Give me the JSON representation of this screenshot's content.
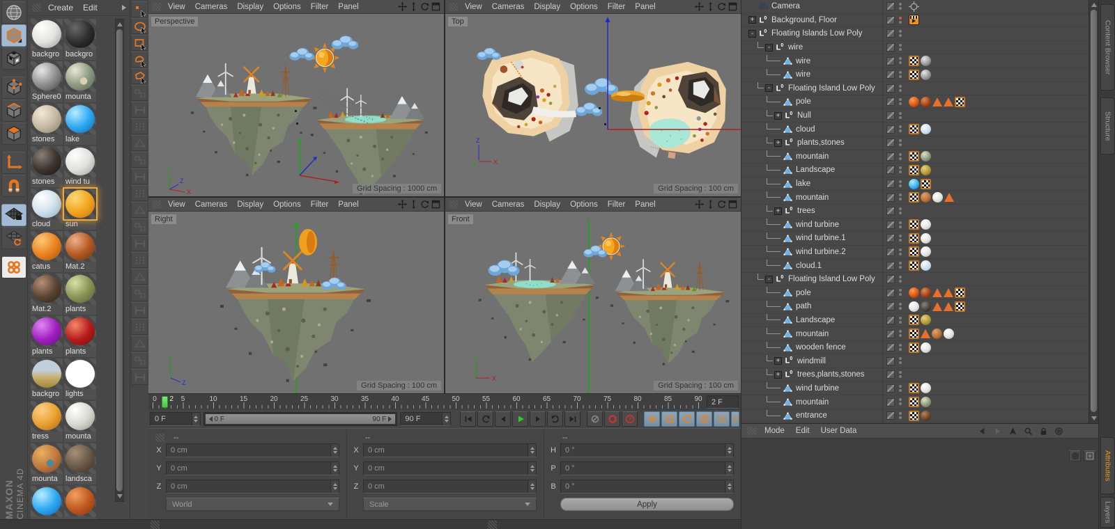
{
  "brand": {
    "maxon": "MAXON",
    "product": "CINEMA 4D"
  },
  "colors": {
    "accent": "#e8821e",
    "selection_blue": "#a2bad4",
    "play_green": "#2fc82f",
    "record_red": "#d23030"
  },
  "left_toolbar_icons": [
    "globe-icon",
    "make-editable-icon",
    "model-mode-icon",
    "points-mode-icon",
    "edges-mode-icon",
    "polygons-mode-icon",
    "axis-mode-icon",
    "snap-icon",
    "lock-workplane-icon",
    "workplane-mode-icon",
    "mograph-icon"
  ],
  "material_manager": {
    "menu": [
      "Create",
      "Edit"
    ],
    "more_icon": "submenu-arrow-icon",
    "materials": [
      {
        "name": "backgro",
        "style": "radial",
        "hi": "#ffffff",
        "base": "#e2e2e0",
        "lo": "#9a9a98"
      },
      {
        "name": "backgro",
        "style": "radial",
        "hi": "#6a6a6a",
        "base": "#2e2e2e",
        "lo": "#111111"
      },
      {
        "name": "Sphere0",
        "style": "radial",
        "hi": "#e8e8e8",
        "base": "#8e8e8e",
        "lo": "#4a4a4a"
      },
      {
        "name": "mounta",
        "style": "mottled",
        "hi": "#e8e8d8",
        "base": "#8e9a80",
        "lo": "#5a665a",
        "spot": "#d8d2b0"
      },
      {
        "name": "stones",
        "style": "radial",
        "hi": "#f0ead8",
        "base": "#c6b8a2",
        "lo": "#8a7e6a"
      },
      {
        "name": "lake",
        "style": "radial",
        "hi": "#b8ecff",
        "base": "#2fa9f2",
        "lo": "#1068b8"
      },
      {
        "name": "stones",
        "style": "radial",
        "hi": "#8a8078",
        "base": "#3c3430",
        "lo": "#1a1614"
      },
      {
        "name": "wind tu",
        "style": "radial",
        "hi": "#ffffff",
        "base": "#e0e0dc",
        "lo": "#a0a09a"
      },
      {
        "name": "cloud",
        "style": "radial",
        "hi": "#ffffff",
        "base": "#cfe0ec",
        "lo": "#92aec2"
      },
      {
        "name": "sun",
        "style": "radial",
        "hi": "#ffd878",
        "base": "#f2a41e",
        "lo": "#c87410",
        "selected": true
      },
      {
        "name": "catus",
        "style": "radial",
        "hi": "#ffc878",
        "base": "#e8821e",
        "lo": "#a85210"
      },
      {
        "name": "Mat.2",
        "style": "radial",
        "hi": "#f0b088",
        "base": "#b35a24",
        "lo": "#703413"
      },
      {
        "name": "Mat.2",
        "style": "radial",
        "hi": "#b89078",
        "base": "#5a4332",
        "lo": "#30241a"
      },
      {
        "name": "plants",
        "style": "radial",
        "hi": "#d8e0a8",
        "base": "#8a9456",
        "lo": "#57613a"
      },
      {
        "name": "plants",
        "style": "radial",
        "hi": "#e088f0",
        "base": "#a020c0",
        "lo": "#601080"
      },
      {
        "name": "plants",
        "style": "radial",
        "hi": "#f08868",
        "base": "#b81c1c",
        "lo": "#700e0e"
      },
      {
        "name": "backgro",
        "style": "sky",
        "hi": "#c2cedb",
        "base": "#c8b070",
        "lo": "#a08838"
      },
      {
        "name": "lights",
        "style": "flat",
        "base": "#ffffff"
      },
      {
        "name": "tress",
        "style": "radial",
        "hi": "#ffd088",
        "base": "#e8a030",
        "lo": "#b06a14"
      },
      {
        "name": "mounta",
        "style": "radial",
        "hi": "#ffffff",
        "base": "#d8d8d2",
        "lo": "#9a9a92"
      },
      {
        "name": "mounta",
        "style": "earth",
        "hi": "#e8b060",
        "base": "#c07840",
        "lo": "#7a4820",
        "spot": "#4a8a9a"
      },
      {
        "name": "landsca",
        "style": "radial",
        "hi": "#a89078",
        "base": "#6a5848",
        "lo": "#3c3028"
      },
      {
        "name": "",
        "style": "radial",
        "hi": "#b8ecff",
        "base": "#2fa9f2",
        "lo": "#1068b8",
        "cut": true
      },
      {
        "name": "",
        "style": "radial",
        "hi": "#f0a060",
        "base": "#c05820",
        "lo": "#803810",
        "cut": true
      }
    ]
  },
  "selection_tools": [
    "live-selection",
    "circle-selection",
    "rectangle-selection",
    "lasso-selection",
    "polygon-selection"
  ],
  "selection_extra_count": 18,
  "viewport_menu": [
    "View",
    "Cameras",
    "Display",
    "Options",
    "Filter",
    "Panel"
  ],
  "viewport_icons": [
    "pan-icon",
    "dolly-icon",
    "rotate-icon",
    "maximize-icon"
  ],
  "viewports": [
    {
      "id": "perspective",
      "label": "Perspective",
      "grid_spacing": "Grid Spacing : 1000 cm"
    },
    {
      "id": "top",
      "label": "Top",
      "grid_spacing": "Grid Spacing : 100 cm"
    },
    {
      "id": "right",
      "label": "Right",
      "grid_spacing": "Grid Spacing : 100 cm"
    },
    {
      "id": "front",
      "label": "Front",
      "grid_spacing": "Grid Spacing : 100 cm"
    }
  ],
  "timeline": {
    "labels": [
      0,
      5,
      10,
      15,
      20,
      25,
      30,
      35,
      40,
      45,
      50,
      55,
      60,
      65,
      70,
      75,
      80,
      85,
      90
    ],
    "max": 90,
    "current_frame": "2",
    "current_field": "2 F",
    "start_field": "0 F",
    "range_start": "0 F",
    "range_end": "90 F",
    "end_field": "90 F"
  },
  "transport": {
    "buttons": [
      "go-to-start",
      "play-backwards",
      "previous-frame",
      "play-forwards",
      "next-frame",
      "play-cycle",
      "go-to-end"
    ],
    "record": [
      "record-disabled",
      "autokeying",
      "record-help"
    ],
    "key_toggles": [
      "key-position",
      "key-scale",
      "key-rotation",
      "key-parameter",
      "key-pla",
      "key-extra"
    ]
  },
  "coordinates": {
    "groups": [
      {
        "header": "--",
        "grip": true,
        "rows": [
          {
            "label": "X",
            "value": "0 cm"
          },
          {
            "label": "Y",
            "value": "0 cm"
          },
          {
            "label": "Z",
            "value": "0 cm"
          }
        ],
        "footer": {
          "type": "dropdown",
          "label": "World"
        }
      },
      {
        "header": "--",
        "rows": [
          {
            "label": "X",
            "value": "0 cm"
          },
          {
            "label": "Y",
            "value": "0 cm"
          },
          {
            "label": "Z",
            "value": "0 cm"
          }
        ],
        "footer": {
          "type": "dropdown",
          "label": "Scale"
        }
      },
      {
        "header": "--",
        "rows": [
          {
            "label": "H",
            "value": "0 °"
          },
          {
            "label": "P",
            "value": "0 °"
          },
          {
            "label": "B",
            "value": "0 °"
          }
        ],
        "footer": {
          "type": "button",
          "label": "Apply"
        }
      }
    ]
  },
  "object_manager": {
    "rows": [
      {
        "i": 0,
        "t": "camera",
        "l": "Camera",
        "g": [
          "target"
        ]
      },
      {
        "i": 0,
        "t": "null",
        "e": "plus",
        "l": "Background, Floor",
        "r": true,
        "g": [
          "film"
        ]
      },
      {
        "i": 0,
        "t": "null",
        "e": "minus",
        "l": "Floating Islands Low Poly",
        "g": []
      },
      {
        "i": 1,
        "t": "null",
        "e": "minus",
        "l": "wire",
        "g": []
      },
      {
        "i": 2,
        "t": "poly",
        "l": "wire",
        "g": [
          "checker",
          "sphere-grey"
        ]
      },
      {
        "i": 2,
        "t": "poly",
        "l": "wire",
        "g": [
          "checker",
          "sphere-grey"
        ]
      },
      {
        "i": 1,
        "t": "null",
        "e": "minus",
        "l": "Floating Island Low Poly",
        "g": []
      },
      {
        "i": 2,
        "t": "poly",
        "l": "pole",
        "g": [
          "sphere-orange",
          "sphere-rust",
          "tri",
          "tri",
          "checker"
        ]
      },
      {
        "i": 2,
        "t": "null",
        "e": "plus",
        "l": "Null",
        "g": []
      },
      {
        "i": 2,
        "t": "poly",
        "l": "cloud",
        "g": [
          "checker",
          "sphere-cloud"
        ]
      },
      {
        "i": 2,
        "t": "null",
        "e": "plus",
        "l": "plants,stones",
        "g": []
      },
      {
        "i": 2,
        "t": "poly",
        "l": "mountain",
        "g": [
          "checker",
          "sphere-mottled"
        ]
      },
      {
        "i": 2,
        "t": "poly",
        "l": "Landscape",
        "g": [
          "checker",
          "sphere-olive"
        ]
      },
      {
        "i": 2,
        "t": "poly",
        "l": "lake",
        "g": [
          "sphere-lake",
          "checker"
        ]
      },
      {
        "i": 2,
        "t": "poly",
        "l": "mountain",
        "g": [
          "checker",
          "sphere-earth",
          "sphere-white",
          "tri"
        ]
      },
      {
        "i": 2,
        "t": "null",
        "e": "plus",
        "l": "trees",
        "g": []
      },
      {
        "i": 2,
        "t": "poly",
        "l": "wind turbine",
        "g": [
          "checker",
          "sphere-white"
        ]
      },
      {
        "i": 2,
        "t": "poly",
        "l": "wind turbine.1",
        "g": [
          "checker",
          "sphere-white"
        ]
      },
      {
        "i": 2,
        "t": "poly",
        "l": "wind turbine.2",
        "g": [
          "checker",
          "sphere-white"
        ]
      },
      {
        "i": 2,
        "t": "poly",
        "l": "cloud.1",
        "g": [
          "checker",
          "sphere-cloud"
        ]
      },
      {
        "i": 1,
        "t": "null",
        "e": "minus",
        "l": "Floating Island Low Poly",
        "g": []
      },
      {
        "i": 2,
        "t": "poly",
        "l": "pole",
        "g": [
          "sphere-orange",
          "sphere-rust",
          "tri",
          "tri",
          "checker"
        ]
      },
      {
        "i": 2,
        "t": "poly",
        "l": "path",
        "g": [
          "sphere-white",
          "sphere-dark",
          "tri",
          "tri",
          "checker"
        ]
      },
      {
        "i": 2,
        "t": "poly",
        "l": "Landscape",
        "g": [
          "checker",
          "sphere-olive"
        ]
      },
      {
        "i": 2,
        "t": "poly",
        "l": "mountain",
        "g": [
          "checker",
          "tri",
          "sphere-earth",
          "sphere-white"
        ]
      },
      {
        "i": 2,
        "t": "poly",
        "l": "wooden fence",
        "g": [
          "checker",
          "sphere-white"
        ]
      },
      {
        "i": 2,
        "t": "null",
        "e": "plus",
        "l": "windmill",
        "g": []
      },
      {
        "i": 2,
        "t": "null",
        "e": "plus",
        "l": "trees,plants,stones",
        "g": []
      },
      {
        "i": 2,
        "t": "poly",
        "l": "wind turbine",
        "g": [
          "checker",
          "sphere-white"
        ]
      },
      {
        "i": 2,
        "t": "poly",
        "l": "mountain",
        "g": [
          "checker",
          "sphere-mottled"
        ]
      },
      {
        "i": 2,
        "t": "poly",
        "l": "entrance",
        "g": [
          "checker",
          "sphere-brown"
        ]
      }
    ]
  },
  "tag_colors": {
    "grey": [
      "#e6e6e6",
      "#9a9a9a",
      "#565656"
    ],
    "cloud": [
      "#f4faff",
      "#cfe0ec",
      "#8caec6"
    ],
    "mottled": [
      "#dee2c4",
      "#8e9a80",
      "#57645a"
    ],
    "olive": [
      "#e6d07c",
      "#b29a3a",
      "#6e5e1c"
    ],
    "lake": [
      "#b0ecff",
      "#38b2f2",
      "#0f6fc0"
    ],
    "earth": [
      "#e2a262",
      "#b87138",
      "#63381a"
    ],
    "white": [
      "#ffffff",
      "#e3e3df",
      "#a6a6a0"
    ],
    "orange": [
      "#ff9b52",
      "#d85812",
      "#7e2d07"
    ],
    "rust": [
      "#dc8c52",
      "#a34219",
      "#541f06"
    ],
    "dark": [
      "#8e857c",
      "#4a443e",
      "#1d1a17"
    ],
    "brown": [
      "#b4845c",
      "#6d472a",
      "#30190b"
    ]
  },
  "attribute_manager": {
    "menu": [
      "Mode",
      "Edit",
      "User Data"
    ],
    "icons": [
      "back-icon",
      "forward-icon",
      "pick-arrow-icon",
      "search-icon",
      "lock-icon",
      "target-icon"
    ]
  },
  "side_tabs": {
    "top": [
      "Content Browser",
      "Structure"
    ],
    "bottom": [
      {
        "label": "Attributes",
        "active": true
      },
      {
        "label": "Layers",
        "active": false
      }
    ]
  }
}
